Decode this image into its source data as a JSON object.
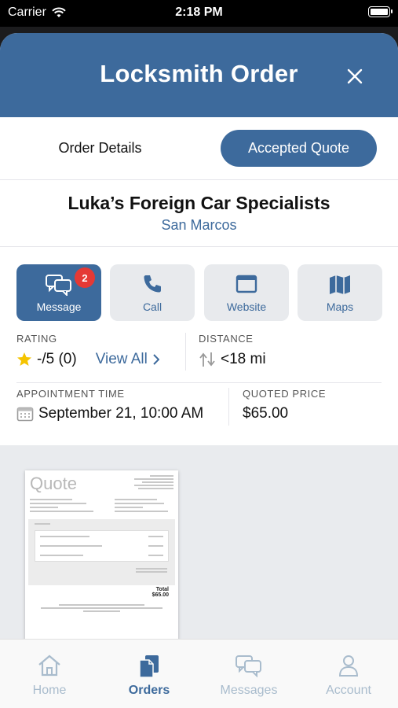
{
  "status_bar": {
    "carrier": "Carrier",
    "time": "2:18 PM"
  },
  "header": {
    "title": "Locksmith Order"
  },
  "tabs": [
    {
      "label": "Order Details",
      "active": false
    },
    {
      "label": "Accepted Quote",
      "active": true
    }
  ],
  "business": {
    "name": "Luka’s Foreign Car Specialists",
    "location": "San Marcos"
  },
  "actions": {
    "message": {
      "label": "Message",
      "badge": "2"
    },
    "call": {
      "label": "Call"
    },
    "website": {
      "label": "Website"
    },
    "maps": {
      "label": "Maps"
    }
  },
  "rating": {
    "label": "RATING",
    "value": "-/5 (0)",
    "view_all": "View All"
  },
  "distance": {
    "label": "DISTANCE",
    "value": "<18 mi"
  },
  "appointment": {
    "label": "APPOINTMENT TIME",
    "value": "September 21, 10:00 AM"
  },
  "price": {
    "label": "QUOTED PRICE",
    "value": "$65.00"
  },
  "quote_preview": {
    "title": "Quote",
    "total_label": "Total",
    "total_value": "$65.00"
  },
  "tabbar": [
    {
      "label": "Home",
      "icon": "home-icon"
    },
    {
      "label": "Orders",
      "icon": "orders-icon",
      "active": true
    },
    {
      "label": "Messages",
      "icon": "messages-icon"
    },
    {
      "label": "Account",
      "icon": "account-icon"
    }
  ],
  "colors": {
    "brand": "#3d6a9c",
    "badge": "#e53935",
    "star": "#f5c400"
  }
}
